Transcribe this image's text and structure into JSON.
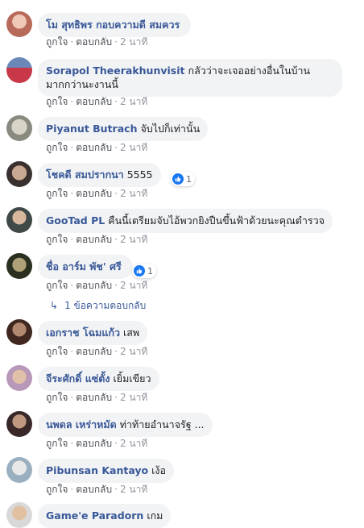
{
  "comments": [
    {
      "author": "โม สุทธิพร กอบความดี สมควร",
      "text": "",
      "like": "ถูกใจ",
      "reply": "ตอบกลับ",
      "time": "2 นาที"
    },
    {
      "author": "Sorapol Theerakhunvisit",
      "text": "กลัวว่าจะเจออย่างอื่นในบ้าน",
      "text2": "มากกว่านะงานนี้",
      "like": "ถูกใจ",
      "reply": "ตอบกลับ",
      "time": "2 นาที"
    },
    {
      "author": "Piyanut Butrach",
      "text": "จับไปก็เท่านั้น",
      "like": "ถูกใจ",
      "reply": "ตอบกลับ",
      "time": "2 นาที"
    },
    {
      "author": "โชคดี สมปรากนา",
      "text": "5555",
      "reactions": "1",
      "like": "ถูกใจ",
      "reply": "ตอบกลับ",
      "time": "2 นาที"
    },
    {
      "author": "GooTad PL",
      "text": "คืนนี้เตรียมจับไอ้พวกยิงปืนขึ้นฟ้าด้วยนะคุณตำรวจ",
      "like": "ถูกใจ",
      "reply": "ตอบกลับ",
      "time": "2 นาที"
    },
    {
      "author": "ชื่อ อาร์ม พัช' ศรี",
      "text": "",
      "reactions": "1",
      "like": "ถูกใจ",
      "reply": "ตอบกลับ",
      "time": "2 นาที"
    },
    {
      "author": "เอกราช โฉมแก้ว",
      "text": "เสพ",
      "like": "ถูกใจ",
      "reply": "ตอบกลับ",
      "time": "2 นาที"
    },
    {
      "author": "จีระศักดิ์ แซ่ตั้ง",
      "text": "เยิ้มเขียว",
      "like": "ถูกใจ",
      "reply": "ตอบกลับ",
      "time": "2 นาที"
    },
    {
      "author": "นพดล เหร่าหมัด",
      "text": "ท่าท้ายอำนาจรัฐ ...",
      "like": "ถูกใจ",
      "reply": "ตอบกลับ",
      "time": "2 นาที"
    },
    {
      "author": "Pibunsan Kantayo",
      "text": "เง้อ",
      "like": "ถูกใจ",
      "reply": "ตอบกลับ",
      "time": "2 นาที"
    },
    {
      "author": "Game'e Paradorn",
      "text": "เกม"
    }
  ],
  "reply_link": {
    "text": "1 ข้อความตอบกลับ"
  },
  "colors": {
    "author": "#385898",
    "bubble": "#f2f3f5",
    "meta": "#90949c",
    "like_blue": "#1877f2"
  }
}
